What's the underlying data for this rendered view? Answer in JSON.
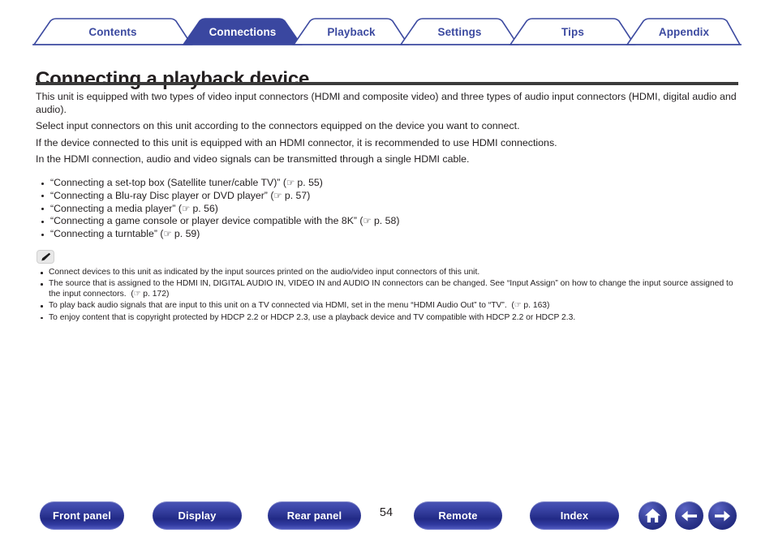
{
  "tabs": [
    {
      "label": "Contents",
      "active": false
    },
    {
      "label": "Connections",
      "active": true
    },
    {
      "label": "Playback",
      "active": false
    },
    {
      "label": "Settings",
      "active": false
    },
    {
      "label": "Tips",
      "active": false
    },
    {
      "label": "Appendix",
      "active": false
    }
  ],
  "page": {
    "title": "Connecting a playback device",
    "number": "54"
  },
  "intro": {
    "line1": "This unit is equipped with two types of video input connectors (HDMI and composite video) and three types of audio input connectors (HDMI, digital audio and audio).",
    "line2": "Select input connectors on this unit according to the connectors equipped on the device you want to connect.",
    "line3": "If the device connected to this unit is equipped with an HDMI connector, it is recommended to use HDMI connections.",
    "line4": "In the HDMI connection, audio and video signals can be transmitted through a single HDMI cable."
  },
  "links": [
    {
      "text": "“Connecting a set-top box (Satellite tuner/cable TV)”",
      "ref_icon": "☞",
      "ref": "p. 55"
    },
    {
      "text": "“Connecting a Blu-ray Disc player or DVD player”",
      "ref_icon": "☞",
      "ref": "p. 57"
    },
    {
      "text": "“Connecting a media player”",
      "ref_icon": "☞",
      "ref": "p. 56"
    },
    {
      "text": "“Connecting a game console or player device compatible with the 8K”",
      "ref_icon": "☞",
      "ref": "p. 58"
    },
    {
      "text": "“Connecting a turntable”",
      "ref_icon": "☞",
      "ref": "p. 59"
    }
  ],
  "note": {
    "icon_name": "pencil-icon",
    "items": [
      {
        "text": "Connect devices to this unit as indicated by the input sources printed on the audio/video input connectors of this unit.",
        "ref_icon": "",
        "ref": "",
        "tail": ""
      },
      {
        "text": "The source that is assigned to the HDMI IN, DIGITAL AUDIO IN, VIDEO IN and AUDIO IN connectors can be changed. See “Input Assign” on how to change the input source assigned to the input connectors.",
        "ref_icon": "☞",
        "ref": "p. 172",
        "tail": ""
      },
      {
        "text": "To play back audio signals that are input to this unit on a TV connected via HDMI, set in the menu “HDMI Audio Out” to “TV”.",
        "ref_icon": "☞",
        "ref": "p. 163",
        "tail": ""
      },
      {
        "text": "To enjoy content that is copyright protected by HDCP 2.2 or HDCP 2.3, use a playback device and TV compatible with HDCP 2.2 or HDCP 2.3.",
        "ref_icon": "",
        "ref": "",
        "tail": ""
      }
    ]
  },
  "footer": {
    "buttons": [
      {
        "label": "Front panel"
      },
      {
        "label": "Display"
      },
      {
        "label": "Rear panel"
      },
      {
        "label": "Remote"
      },
      {
        "label": "Index"
      }
    ],
    "icon_buttons": [
      {
        "name": "home-icon"
      },
      {
        "name": "back-arrow-icon"
      },
      {
        "name": "forward-arrow-icon"
      }
    ]
  },
  "colors": {
    "accent": "#3c4aa0",
    "active_tab_bg": "#3a47a0",
    "rule": "#3c3c3c",
    "text": "#231f20"
  }
}
